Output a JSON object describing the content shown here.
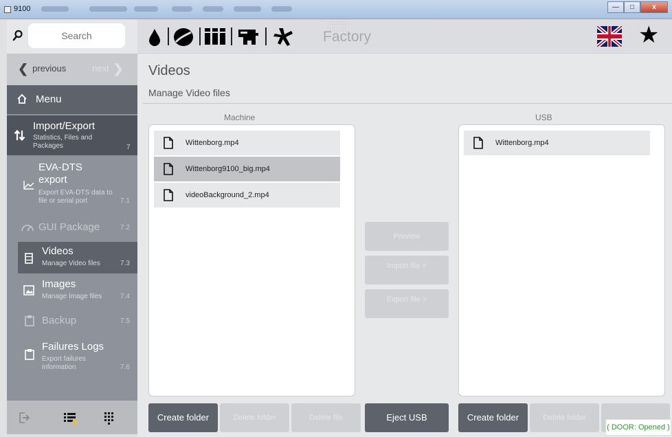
{
  "window": {
    "title": "9100",
    "buttons": {
      "minimize": "—",
      "maximize": "□",
      "close": "x"
    }
  },
  "sidebar": {
    "search_placeholder": "Search",
    "nav": {
      "previous": "previous",
      "next": "next"
    },
    "menu_label": "Menu",
    "import_export": {
      "title": "Import/Export",
      "subtitle": "Statistics, Files and Packages",
      "number": "7"
    },
    "items": [
      {
        "title": "EVA-DTS export",
        "subtitle": "Export EVA-DTS data to file or serial port",
        "number": "7.1"
      },
      {
        "title": "GUI Package",
        "subtitle": "",
        "number": "7.2"
      },
      {
        "title": "Videos",
        "subtitle": "Manage Video files",
        "number": "7.3"
      },
      {
        "title": "Images",
        "subtitle": "Manage Image files",
        "number": "7.4"
      },
      {
        "title": "Backup",
        "subtitle": "",
        "number": "7.5"
      },
      {
        "title": "Failures Logs",
        "subtitle": "Export failures information",
        "number": "7.6"
      }
    ]
  },
  "toolbar": {
    "label": "Factory"
  },
  "page": {
    "title": "Videos",
    "subtitle": "Manage Video files"
  },
  "machine": {
    "header": "Machine",
    "files": [
      "Wittenborg.mp4",
      "Wittenborg9100_big.mp4",
      "videoBackground_2.mp4"
    ],
    "selected_index": 1
  },
  "usb": {
    "header": "USB",
    "files": [
      "Wittenborg.mp4"
    ]
  },
  "actions": {
    "preview": "Preview",
    "import": "Import file <",
    "export": "Export file >"
  },
  "bottom_buttons": {
    "machine_create_folder": "Create folder",
    "machine_delete_folder": "Delete folder",
    "machine_delete_file": "Delete file",
    "eject_usb": "Eject USB",
    "usb_create_folder": "Create folder",
    "usb_delete_folder": "Delete folder"
  },
  "status": {
    "door": "( DOOR: Opened )"
  }
}
